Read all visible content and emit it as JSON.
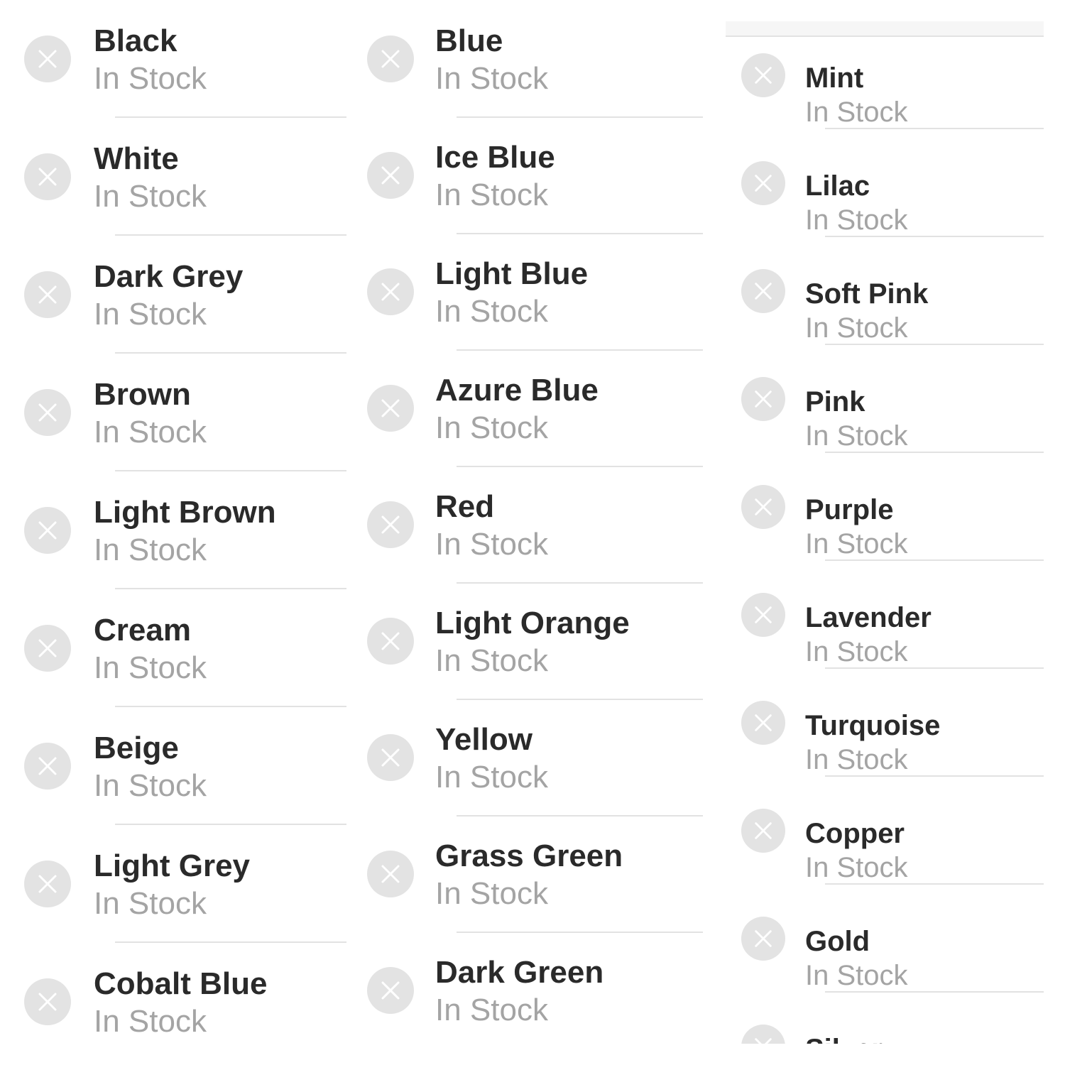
{
  "colors": {
    "name": "#2a2a2a",
    "status": "#a4a4a4",
    "clear_button": "#e3e3e3",
    "separator": "#e2e2e2"
  },
  "icons": {
    "clear": "close-icon"
  },
  "columns": [
    {
      "items": [
        {
          "name": "Black",
          "status": "In Stock"
        },
        {
          "name": "White",
          "status": "In Stock"
        },
        {
          "name": "Dark Grey",
          "status": "In Stock"
        },
        {
          "name": "Brown",
          "status": "In Stock"
        },
        {
          "name": "Light Brown",
          "status": "In Stock"
        },
        {
          "name": "Cream",
          "status": "In Stock"
        },
        {
          "name": "Beige",
          "status": "In Stock"
        },
        {
          "name": "Light Grey",
          "status": "In Stock"
        },
        {
          "name": "Cobalt Blue",
          "status": "In Stock"
        }
      ]
    },
    {
      "items": [
        {
          "name": "Blue",
          "status": "In Stock"
        },
        {
          "name": "Ice Blue",
          "status": "In Stock"
        },
        {
          "name": "Light Blue",
          "status": "In Stock"
        },
        {
          "name": "Azure Blue",
          "status": "In Stock"
        },
        {
          "name": "Red",
          "status": "In Stock"
        },
        {
          "name": "Light Orange",
          "status": "In Stock"
        },
        {
          "name": "Yellow",
          "status": "In Stock"
        },
        {
          "name": "Grass Green",
          "status": "In Stock"
        },
        {
          "name": "Dark Green",
          "status": "In Stock"
        }
      ]
    },
    {
      "items": [
        {
          "name": "Mint",
          "status": "In Stock"
        },
        {
          "name": "Lilac",
          "status": "In Stock"
        },
        {
          "name": "Soft Pink",
          "status": "In Stock"
        },
        {
          "name": "Pink",
          "status": "In Stock"
        },
        {
          "name": "Purple",
          "status": "In Stock"
        },
        {
          "name": "Lavender",
          "status": "In Stock"
        },
        {
          "name": "Turquoise",
          "status": "In Stock"
        },
        {
          "name": "Copper",
          "status": "In Stock"
        },
        {
          "name": "Gold",
          "status": "In Stock"
        },
        {
          "name": "Silver",
          "status": ""
        }
      ]
    }
  ]
}
